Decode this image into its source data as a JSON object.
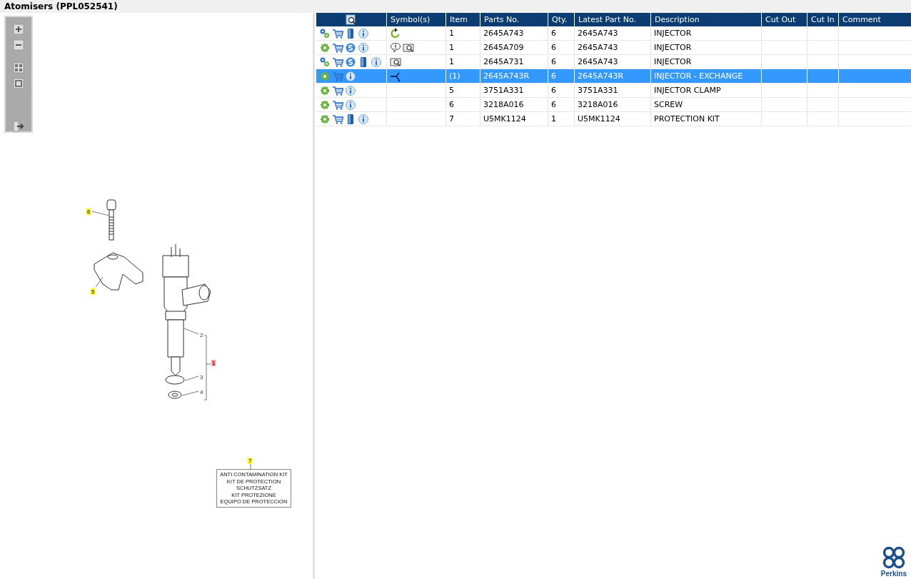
{
  "window": {
    "title": "Atomisers (PPL052541)"
  },
  "toolbar": [
    {
      "kind": "zoom-in"
    },
    {
      "kind": "zoom-out"
    },
    {
      "kind": "fit"
    },
    {
      "kind": "actual"
    },
    {
      "kind": "export"
    }
  ],
  "diagram": {
    "callouts": [
      {
        "label": "6",
        "color": "#ffff00"
      },
      {
        "label": "5",
        "color": "#ffff00"
      },
      {
        "label": "1",
        "color": "#ff9999"
      },
      {
        "label": "7",
        "color": "#ffff00"
      }
    ],
    "numbers": [
      "2",
      "3",
      "4"
    ],
    "kit_label": [
      "ANTI CONTAMINATION KIT",
      "KIT DE PROTECTION",
      "SCHUTZSATZ",
      "KIT PROTEZIONE",
      "EQUIPO DE PROTECCION"
    ]
  },
  "table": {
    "columns": [
      "",
      "Symbol(s)",
      "Item",
      "Parts No.",
      "Qty.",
      "Latest Part No.",
      "Description",
      "Cut Out",
      "Cut In",
      "Comment"
    ],
    "rows": [
      {
        "selected": false,
        "actions": [
          {
            "kind": "gears"
          },
          {
            "kind": "cart"
          },
          {
            "kind": "book"
          },
          {
            "kind": "info"
          }
        ],
        "symbols": [
          {
            "kind": "rotate"
          }
        ],
        "cells": [
          "",
          "",
          "1",
          "2645A743",
          "6",
          "2645A743",
          "INJECTOR",
          "",
          "",
          ""
        ]
      },
      {
        "selected": false,
        "actions": [
          {
            "kind": "gear"
          },
          {
            "kind": "cart"
          },
          {
            "kind": "s"
          },
          {
            "kind": "info"
          }
        ],
        "symbols": [
          {
            "kind": "alert"
          },
          {
            "kind": "lookup"
          }
        ],
        "cells": [
          "",
          "",
          "1",
          "2645A709",
          "6",
          "2645A743",
          "INJECTOR",
          "",
          "",
          ""
        ]
      },
      {
        "selected": false,
        "actions": [
          {
            "kind": "gears"
          },
          {
            "kind": "cart"
          },
          {
            "kind": "s"
          },
          {
            "kind": "book"
          },
          {
            "kind": "info"
          }
        ],
        "symbols": [
          {
            "kind": "lookup"
          }
        ],
        "cells": [
          "",
          "",
          "1",
          "2645A731",
          "6",
          "2645A743",
          "INJECTOR",
          "",
          "",
          ""
        ]
      },
      {
        "selected": true,
        "actions": [
          {
            "kind": "gear"
          },
          {
            "kind": "cart"
          },
          {
            "kind": "info"
          }
        ],
        "symbols": [
          {
            "kind": "exchange"
          }
        ],
        "cells": [
          "",
          "",
          "(1)",
          "2645A743R",
          "6",
          "2645A743R",
          "INJECTOR - EXCHANGE",
          "",
          "",
          ""
        ]
      },
      {
        "selected": false,
        "actions": [
          {
            "kind": "gear"
          },
          {
            "kind": "cart"
          },
          {
            "kind": "info"
          }
        ],
        "symbols": [],
        "cells": [
          "",
          "",
          "5",
          "3751A331",
          "6",
          "3751A331",
          "INJECTOR CLAMP",
          "",
          "",
          ""
        ]
      },
      {
        "selected": false,
        "actions": [
          {
            "kind": "gear"
          },
          {
            "kind": "cart"
          },
          {
            "kind": "info"
          }
        ],
        "symbols": [],
        "cells": [
          "",
          "",
          "6",
          "3218A016",
          "6",
          "3218A016",
          "SCREW",
          "",
          "",
          ""
        ]
      },
      {
        "selected": false,
        "actions": [
          {
            "kind": "gear"
          },
          {
            "kind": "cart"
          },
          {
            "kind": "book"
          },
          {
            "kind": "info"
          }
        ],
        "symbols": [],
        "cells": [
          "",
          "",
          "7",
          "U5MK1124",
          "1",
          "U5MK1124",
          "PROTECTION KIT",
          "",
          "",
          ""
        ]
      }
    ]
  },
  "logo": {
    "text": "Perkins"
  }
}
